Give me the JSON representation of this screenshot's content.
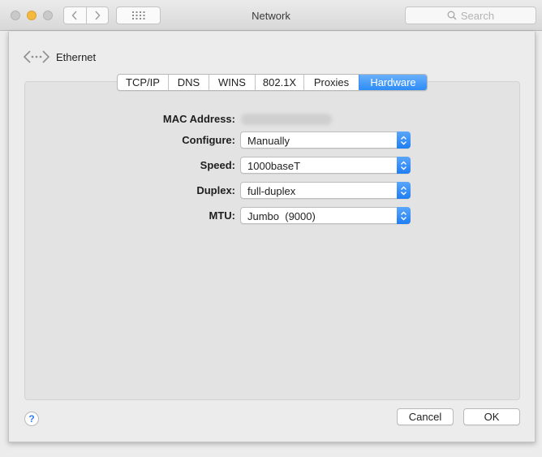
{
  "window": {
    "title": "Network"
  },
  "toolbar": {
    "back_icon": "chevron-left-icon",
    "forward_icon": "chevron-right-icon",
    "grid_icon": "show-all-grid-icon",
    "search_placeholder": "Search"
  },
  "interface": {
    "name": "Ethernet",
    "icon": "ethernet-icon"
  },
  "tabs": [
    {
      "label": "TCP/IP",
      "active": false
    },
    {
      "label": "DNS",
      "active": false
    },
    {
      "label": "WINS",
      "active": false
    },
    {
      "label": "802.1X",
      "active": false
    },
    {
      "label": "Proxies",
      "active": false
    },
    {
      "label": "Hardware",
      "active": true
    }
  ],
  "hardware": {
    "mac_label": "MAC Address:",
    "configure_label": "Configure:",
    "configure_value": "Manually",
    "speed_label": "Speed:",
    "speed_value": "1000baseT",
    "duplex_label": "Duplex:",
    "duplex_value": "full-duplex",
    "mtu_label": "MTU:",
    "mtu_value": "Jumbo  (9000)"
  },
  "footer": {
    "help_label": "?",
    "cancel_label": "Cancel",
    "ok_label": "OK"
  },
  "colors": {
    "accent": "#2c8cf6",
    "minimize": "#f5b93c"
  }
}
